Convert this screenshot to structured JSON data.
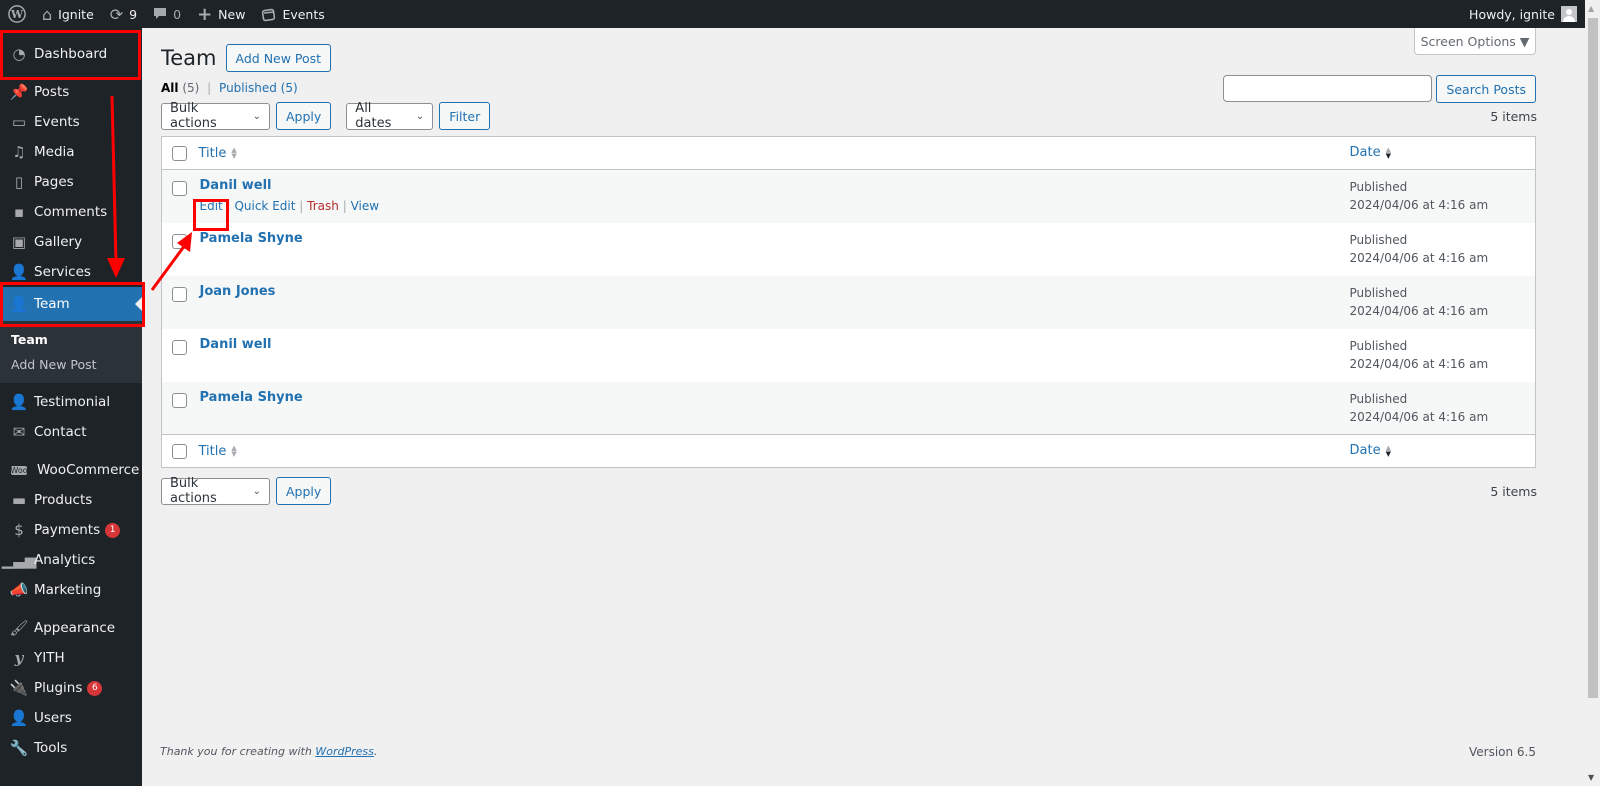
{
  "adminbar": {
    "site_name": "Ignite",
    "updates_count": "9",
    "comments_count": "0",
    "new_label": "New",
    "events_label": "Events",
    "greeting": "Howdy, ignite"
  },
  "sidebar": {
    "items": [
      {
        "label": "Dashboard",
        "icon": "dashboard-icon"
      },
      {
        "label": "Posts",
        "icon": "pin-icon"
      },
      {
        "label": "Events",
        "icon": "calendar-icon"
      },
      {
        "label": "Media",
        "icon": "media-icon"
      },
      {
        "label": "Pages",
        "icon": "pages-icon"
      },
      {
        "label": "Comments",
        "icon": "comment-icon"
      },
      {
        "label": "Gallery",
        "icon": "gallery-icon"
      },
      {
        "label": "Services",
        "icon": "person-icon"
      },
      {
        "label": "Team",
        "icon": "person-icon",
        "current": true
      },
      {
        "label": "Testimonial",
        "icon": "person-icon"
      },
      {
        "label": "Contact",
        "icon": "envelope-icon"
      },
      {
        "label": "WooCommerce",
        "icon": "woo-icon"
      },
      {
        "label": "Products",
        "icon": "archive-icon"
      },
      {
        "label": "Payments",
        "icon": "dollar-icon",
        "badge": "1"
      },
      {
        "label": "Analytics",
        "icon": "bar-chart-icon"
      },
      {
        "label": "Marketing",
        "icon": "megaphone-icon"
      },
      {
        "label": "Appearance",
        "icon": "brush-icon"
      },
      {
        "label": "YITH",
        "icon": "yith-icon"
      },
      {
        "label": "Plugins",
        "icon": "plug-icon",
        "badge": "6"
      },
      {
        "label": "Users",
        "icon": "person-icon"
      },
      {
        "label": "Tools",
        "icon": "wrench-icon"
      }
    ],
    "submenu": [
      "Team",
      "Add New Post"
    ]
  },
  "header": {
    "title": "Team",
    "add_new_label": "Add New Post",
    "screen_options_label": "Screen Options ▼"
  },
  "filters": {
    "all_label": "All",
    "all_count": "(5)",
    "separator": "|",
    "published_label": "Published (5)"
  },
  "search": {
    "value": "",
    "button_label": "Search Posts"
  },
  "tablenav": {
    "bulk_actions": "Bulk actions",
    "apply_label": "Apply",
    "dates": "All dates",
    "filter_label": "Filter",
    "items_count": "5 items"
  },
  "table": {
    "columns": [
      "Title",
      "Date"
    ],
    "rows": [
      {
        "title": "Danil well",
        "status": "Published",
        "date": "2024/04/06 at 4:16 am",
        "show_actions": true
      },
      {
        "title": "Pamela Shyne",
        "status": "Published",
        "date": "2024/04/06 at 4:16 am"
      },
      {
        "title": "Joan Jones",
        "status": "Published",
        "date": "2024/04/06 at 4:16 am"
      },
      {
        "title": "Danil well",
        "status": "Published",
        "date": "2024/04/06 at 4:16 am"
      },
      {
        "title": "Pamela Shyne",
        "status": "Published",
        "date": "2024/04/06 at 4:16 am"
      }
    ],
    "row_actions": {
      "edit": "Edit",
      "quick_edit": "Quick Edit",
      "trash": "Trash",
      "view": "View",
      "sep": "|"
    }
  },
  "footer": {
    "thanks_prefix": "Thank you for creating with ",
    "link": "WordPress",
    "suffix": ".",
    "version": "Version 6.5"
  },
  "colors": {
    "accent": "#2271b1",
    "sidebar_bg": "#1d2327",
    "annotation": "#ff0000",
    "trash": "#b32d2e"
  }
}
